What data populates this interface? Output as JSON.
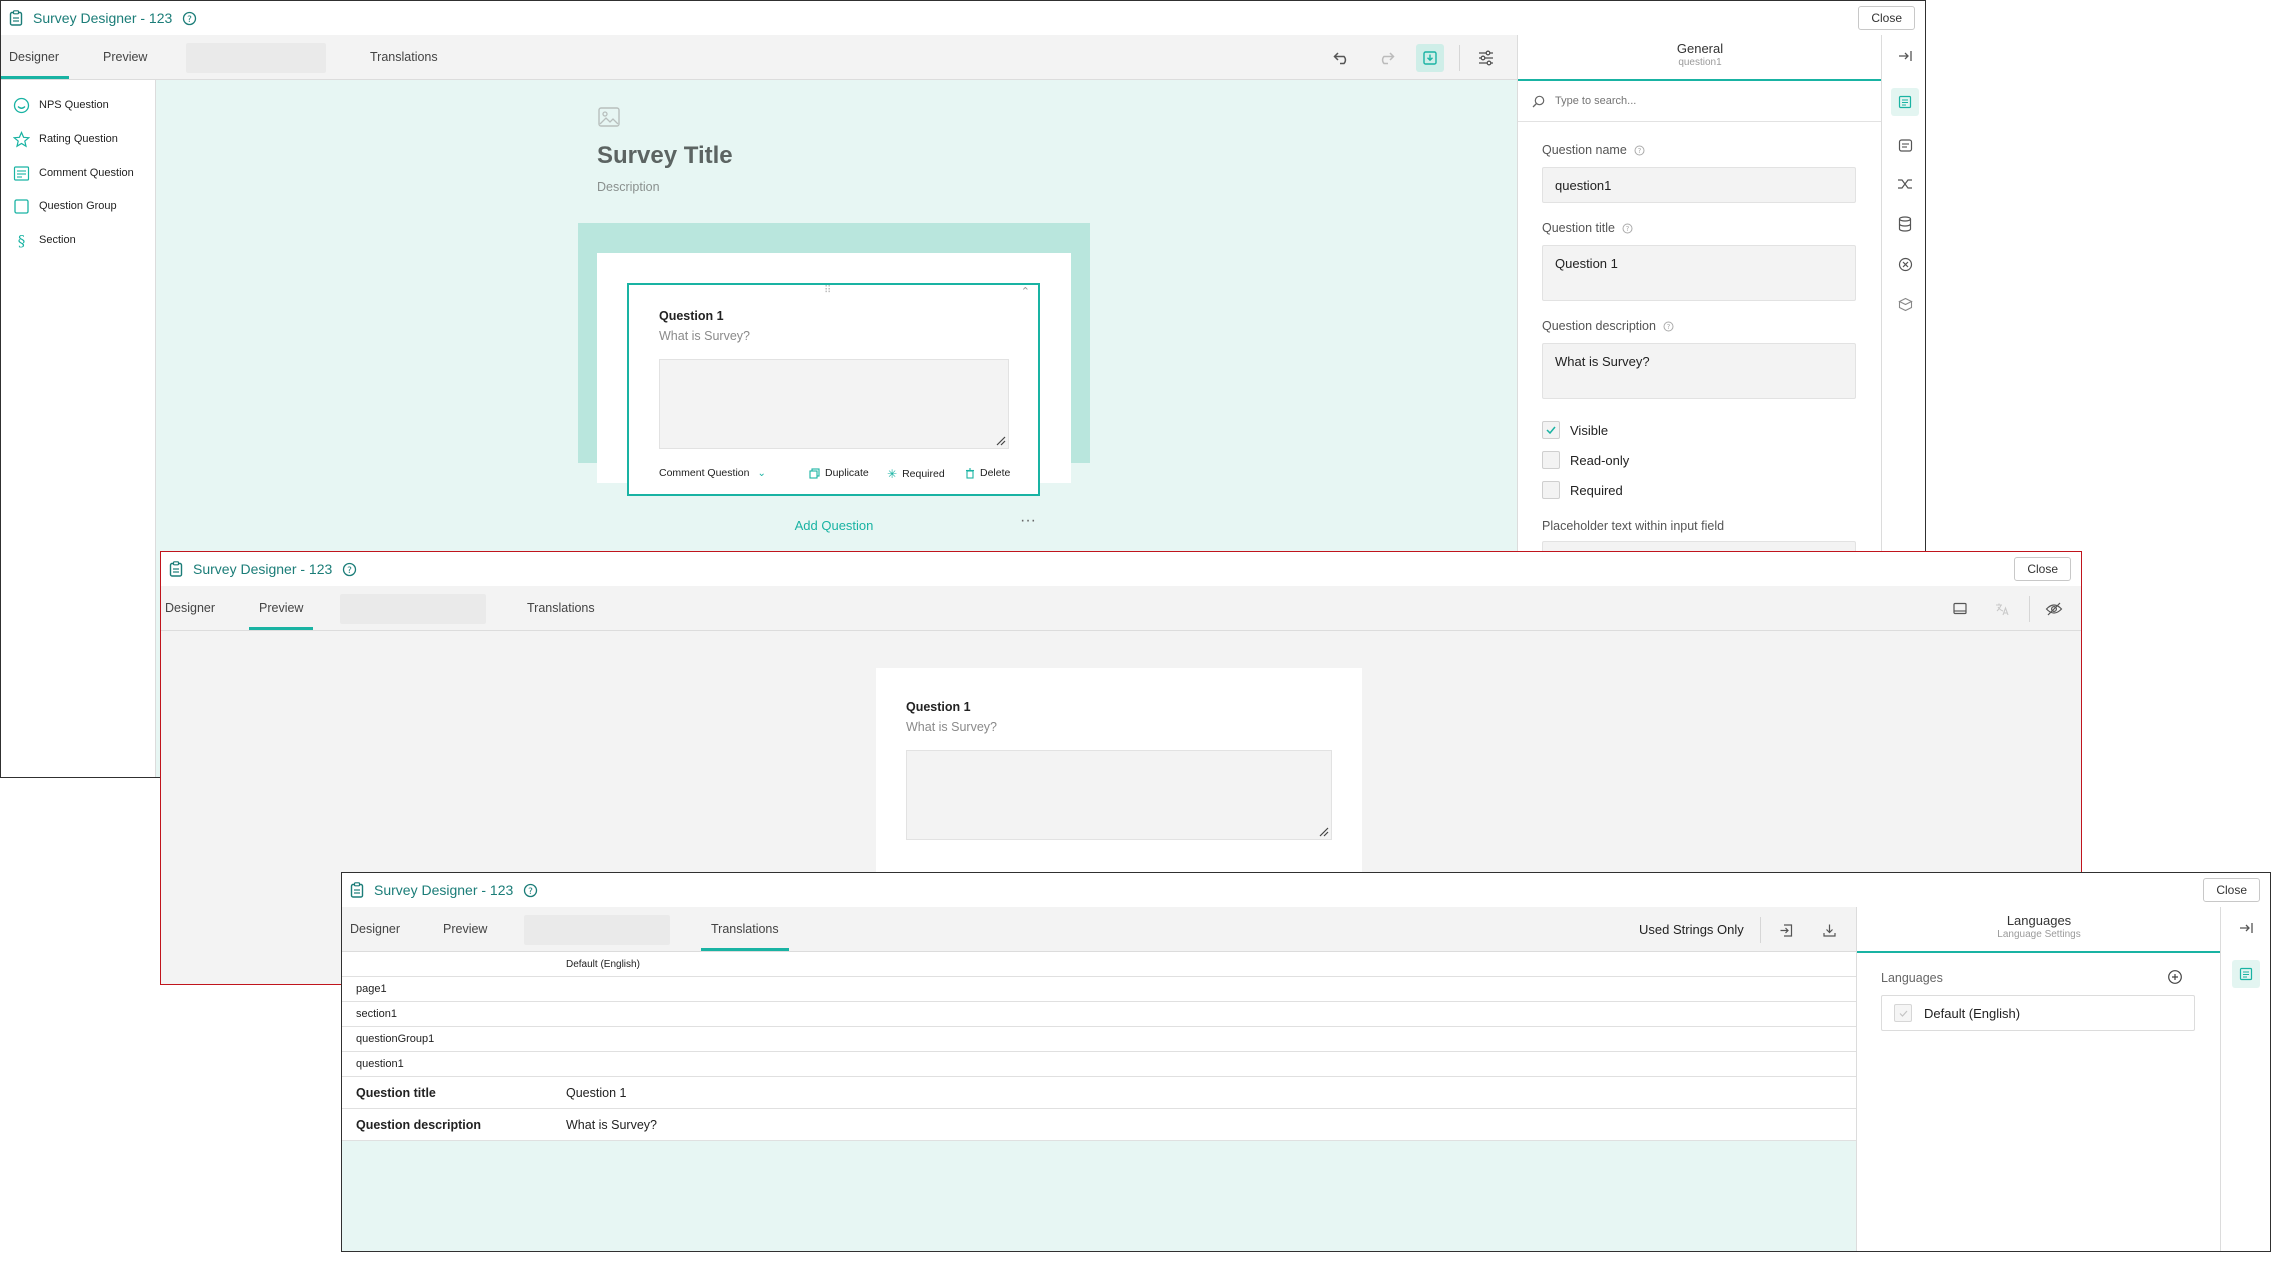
{
  "designer": {
    "title": "Survey Designer - 123",
    "close_label": "Close",
    "tabs": [
      "Designer",
      "Preview",
      "Translations"
    ],
    "toolbox": [
      "NPS Question",
      "Rating Question",
      "Comment Question",
      "Question Group",
      "Section"
    ],
    "survey_title": "Survey Title",
    "survey_description": "Description",
    "question": {
      "title": "Question 1",
      "description": "What is Survey?",
      "type_label": "Comment Question",
      "duplicate_label": "Duplicate",
      "required_label": "Required",
      "delete_label": "Delete"
    },
    "add_question_label": "Add Question",
    "more_label": "···",
    "panel": {
      "heading": "General",
      "subheading": "question1",
      "search_placeholder": "Type to search...",
      "question_name_label": "Question name",
      "question_name_value": "question1",
      "question_title_label": "Question title",
      "question_title_value": "Question 1",
      "question_description_label": "Question description",
      "question_description_value": "What is Survey?",
      "visible_label": "Visible",
      "readonly_label": "Read-only",
      "required_label": "Required",
      "placeholder_label": "Placeholder text within input field"
    }
  },
  "preview": {
    "title": "Survey Designer - 123",
    "close_label": "Close",
    "tabs": [
      "Designer",
      "Preview",
      "Translations"
    ],
    "question_title": "Question 1",
    "question_description": "What is Survey?"
  },
  "translations": {
    "title": "Survey Designer - 123",
    "close_label": "Close",
    "tabs": [
      "Designer",
      "Preview",
      "Translations"
    ],
    "used_strings_label": "Used Strings Only",
    "column_header": "Default (English)",
    "rows": [
      {
        "key": "page1",
        "value": ""
      },
      {
        "key": "section1",
        "value": ""
      },
      {
        "key": "questionGroup1",
        "value": ""
      },
      {
        "key": "question1",
        "value": ""
      },
      {
        "key": "Question title",
        "value": "Question 1"
      },
      {
        "key": "Question description",
        "value": "What is Survey?"
      }
    ],
    "panel": {
      "heading": "Languages",
      "subheading": "Language Settings",
      "languages_label": "Languages",
      "default_language": "Default (English)"
    }
  },
  "colors": {
    "accent": "#19b3a3",
    "title_text": "#1b7d78",
    "canvas_bg": "#e7f6f3",
    "page_frame": "#b9e6dd",
    "preview_border": "#c0141c"
  }
}
